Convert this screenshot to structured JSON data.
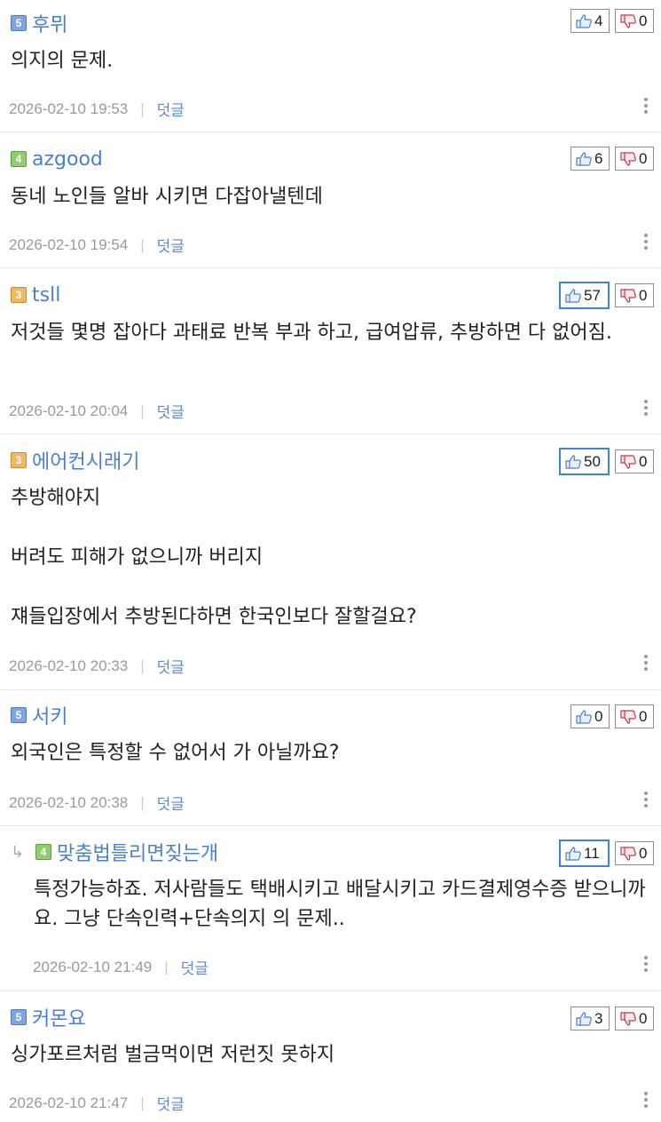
{
  "comments": [
    {
      "level": "5",
      "nick": "후뮈",
      "up": "4",
      "down": "0",
      "text": "의지의 문제.",
      "date": "2026-02-10 19:53",
      "reply_label": "덧글"
    },
    {
      "level": "4",
      "nick": "azgood",
      "up": "6",
      "down": "0",
      "text": "동네 노인들 알바 시키면 다잡아낼텐데",
      "date": "2026-02-10 19:54",
      "reply_label": "덧글"
    },
    {
      "level": "3",
      "nick": "tsll",
      "up": "57",
      "down": "0",
      "text": "저것들 몇명 잡아다 과태료 반복 부과 하고, 급여압류, 추방하면 다 없어짐.",
      "date": "2026-02-10 20:04",
      "reply_label": "덧글"
    },
    {
      "level": "3",
      "nick": "에어컨시래기",
      "up": "50",
      "down": "0",
      "lines": [
        "추방해야지",
        "버려도 피해가 없으니까 버리지",
        "쟤들입장에서 추방된다하면 한국인보다 잘할걸요?"
      ],
      "date": "2026-02-10 20:33",
      "reply_label": "덧글"
    },
    {
      "level": "5",
      "nick": "서키",
      "up": "0",
      "down": "0",
      "text": "외국인은 특정할 수 없어서 가 아닐까요?",
      "date": "2026-02-10 20:38",
      "reply_label": "덧글"
    },
    {
      "level": "4",
      "nick": "맞춤법틀리면짖는개",
      "up": "11",
      "down": "0",
      "text": "특정가능하죠. 저사람들도 택배시키고 배달시키고 카드결제영수증 받으니까요. 그냥 단속인력+단속의지 의 문제..",
      "date": "2026-02-10 21:49",
      "reply_label": "덧글"
    },
    {
      "level": "5",
      "nick": "커몬요",
      "up": "3",
      "down": "0",
      "text": "싱가포르처럼 벌금먹이면 저런짓 못하지",
      "date": "2026-02-10 21:47",
      "reply_label": "덧글"
    }
  ]
}
